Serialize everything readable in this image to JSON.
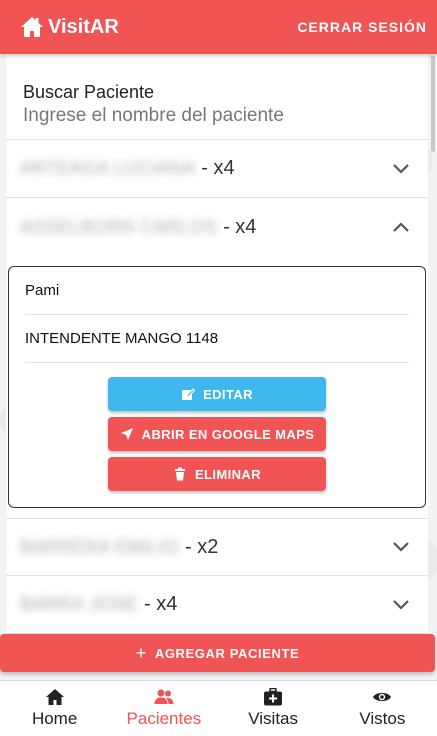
{
  "app": {
    "name": "VisitAR",
    "logout_label": "CERRAR SESIÓN"
  },
  "search": {
    "label": "Buscar Paciente",
    "placeholder": "Ingrese el nombre del paciente"
  },
  "patients": [
    {
      "name": "ARTEAGA LUCIANA",
      "count": "- x4",
      "expanded": false
    },
    {
      "name": "ASSELBORN CARLOS",
      "count": "- x4",
      "expanded": true,
      "details": {
        "insurance": "Pami",
        "address": "INTENDENTE MANGO 1148"
      }
    },
    {
      "name": "BARRERA EMILIO",
      "count": "- x2",
      "expanded": false
    },
    {
      "name": "BARRA JOSE",
      "count": "- x4",
      "expanded": false
    }
  ],
  "actions": {
    "edit": "EDITAR",
    "maps": "ABRIR EN GOOGLE MAPS",
    "delete": "ELIMINAR"
  },
  "add_patient_label": "AGREGAR PACIENTE",
  "nav": [
    {
      "label": "Home",
      "icon": "home-icon",
      "active": false
    },
    {
      "label": "Pacientes",
      "icon": "people-icon",
      "active": true
    },
    {
      "label": "Visitas",
      "icon": "medkit-icon",
      "active": false
    },
    {
      "label": "Vistos",
      "icon": "eye-icon",
      "active": false
    }
  ],
  "colors": {
    "primary": "#f05454",
    "edit": "#3fb8f0",
    "active_nav": "#f05454"
  }
}
